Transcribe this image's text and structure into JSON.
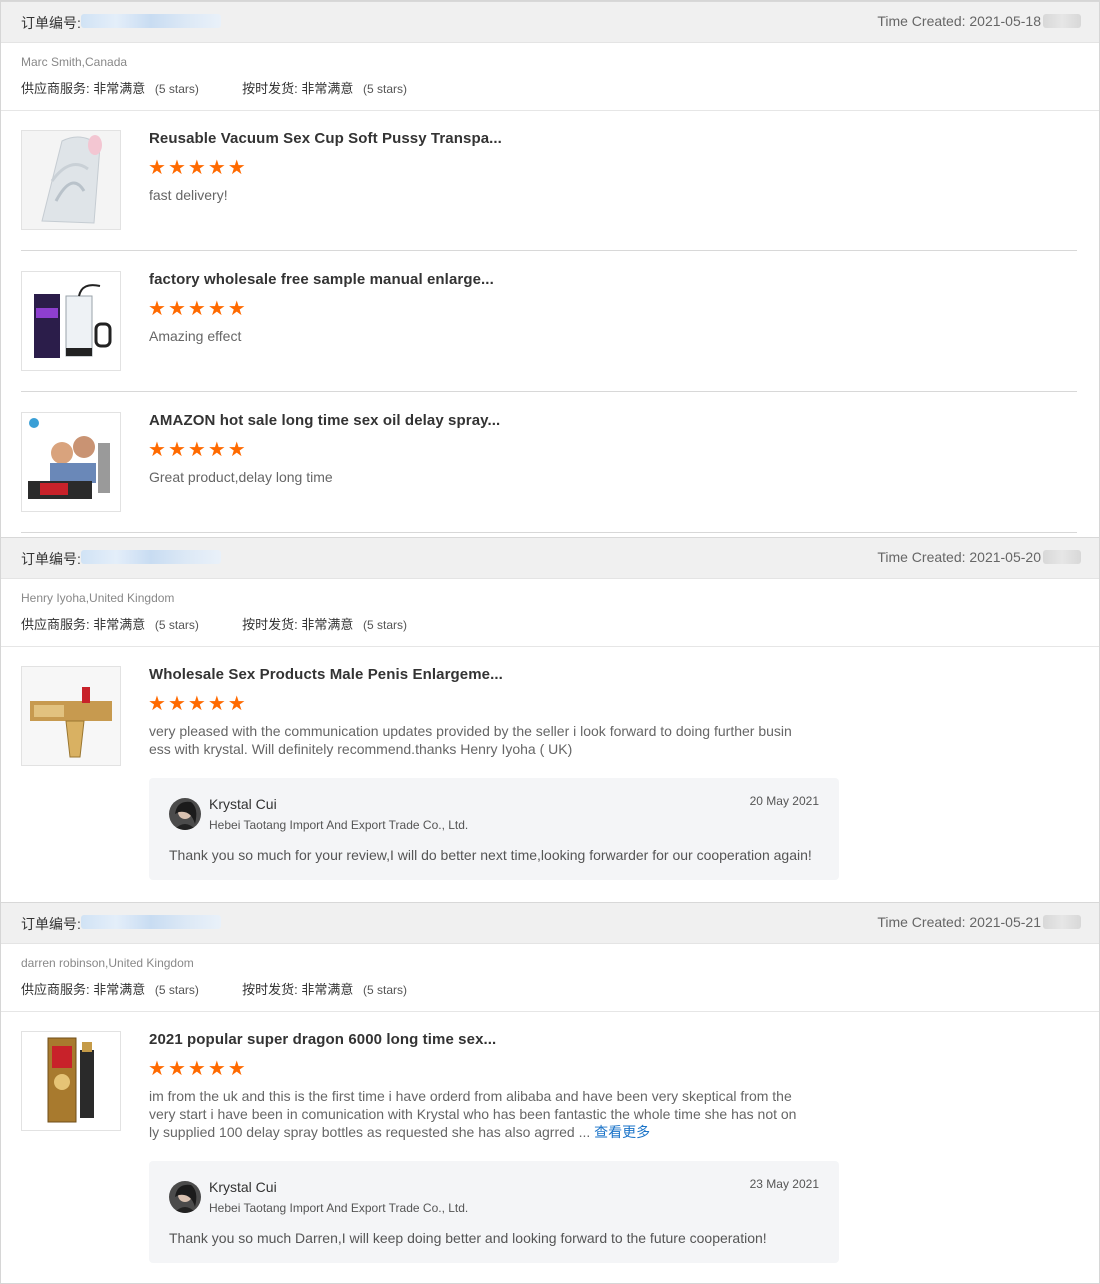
{
  "order_label": "订单编号:",
  "orders": [
    {
      "created": "Time Created: 2021-05-18",
      "buyer": "Marc Smith,Canada",
      "supplier_service_label": "供应商服务:",
      "supplier_service_value": "非常满意",
      "supplier_service_stars": "(5 stars)",
      "on_time_label": "按时发货:",
      "on_time_value": "非常满意",
      "on_time_stars": "(5 stars)",
      "items": [
        {
          "title": "Reusable Vacuum Sex Cup Soft Pussy Transpa...",
          "rating": 5,
          "comment": "fast delivery!",
          "thumb_icon": "clear-cup-product-image"
        },
        {
          "title": "factory wholesale free sample manual enlarge...",
          "rating": 5,
          "comment": "Amazing effect",
          "thumb_icon": "pump-product-image"
        },
        {
          "title": "AMAZON hot sale long time sex oil delay spray...",
          "rating": 5,
          "comment": "Great product,delay long time",
          "thumb_icon": "spray-box-product-image"
        }
      ]
    },
    {
      "created": "Time Created: 2021-05-20",
      "buyer": "Henry Iyoha,United Kingdom",
      "supplier_service_label": "供应商服务:",
      "supplier_service_value": "非常满意",
      "supplier_service_stars": "(5 stars)",
      "on_time_label": "按时发货:",
      "on_time_value": "非常满意",
      "on_time_stars": "(5 stars)",
      "items": [
        {
          "title": "Wholesale Sex Products Male Penis Enlargeme...",
          "rating": 5,
          "comment": "very pleased with the communication updates provided by the seller i look forward to doing further business with krystal. Will definitely recommend.thanks Henry Iyoha ( UK)",
          "thumb_icon": "tube-product-image"
        }
      ],
      "reply": {
        "name": "Krystal Cui",
        "company": "Hebei Taotang Import And Export Trade Co., Ltd.",
        "date": "20 May 2021",
        "text": "Thank you so much for your review,I will do better next time,looking forwarder for our cooperation again!"
      }
    },
    {
      "created": "Time Created: 2021-05-21",
      "buyer": "darren robinson,United Kingdom",
      "supplier_service_label": "供应商服务:",
      "supplier_service_value": "非常满意",
      "supplier_service_stars": "(5 stars)",
      "on_time_label": "按时发货:",
      "on_time_value": "非常满意",
      "on_time_stars": "(5 stars)",
      "items": [
        {
          "title": "2021 popular super dragon 6000 long time sex...",
          "rating": 5,
          "comment": "im from the uk and this is the first time i have orderd from alibaba and have been very skeptical from the very start i have been in comunication with Krystal who has been fantastic the whole time she has not only supplied 100 delay spray bottles as requested she has also agrred ...",
          "more": "查看更多",
          "thumb_icon": "dragon-spray-product-image"
        }
      ],
      "reply": {
        "name": "Krystal Cui",
        "company": "Hebei Taotang Import And Export Trade Co., Ltd.",
        "date": "23 May 2021",
        "text": "Thank you so much Darren,I will keep doing better and looking forward to the future cooperation!"
      }
    }
  ],
  "colors": {
    "star": "#ff6a00",
    "link": "#1a73c8",
    "header_bg": "#f0f0f0",
    "reply_bg": "#f4f5f7"
  }
}
